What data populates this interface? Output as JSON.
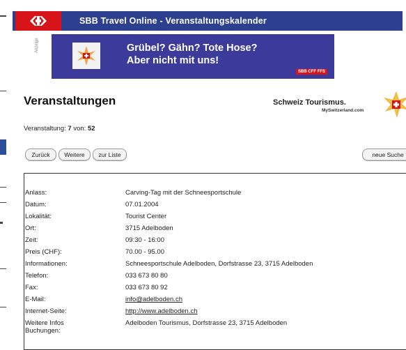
{
  "window": {
    "title": "SBB Travel Online - Veranstaltungskalender"
  },
  "banner": {
    "line1": "Grübel?  Gähn?  Tote Hose?",
    "line2": "Aber nicht mit uns!",
    "brand": "SBB CFF FFS",
    "side_label": "Anzeige"
  },
  "page": {
    "title": "Veranstaltungen",
    "tourism_name": "Schweiz Tourismus.",
    "tourism_site": "MySwitzerland.com",
    "counter_label": "Veranstaltung:",
    "counter_current": "7",
    "counter_of": "von:",
    "counter_total": "52"
  },
  "buttons": {
    "back": "Zurück",
    "next": "Weitere",
    "list": "zur Liste",
    "new_search": "neue Suche"
  },
  "details": [
    {
      "label": "Anlass:",
      "value": "Carving-Tag mit der Schneesportschule"
    },
    {
      "label": "Datum:",
      "value": "07.01.2004"
    },
    {
      "label": "Lokalität:",
      "value": "Tourist Center"
    },
    {
      "label": "Ort:",
      "value": "3715 Adelboden"
    },
    {
      "label": "Zeit:",
      "value": "09:30 - 16:00"
    },
    {
      "label": "Preis (CHF):",
      "value": "70.00 - 95.00"
    },
    {
      "label": "Informationen:",
      "value": "Schneesportschule Adelboden, Dorfstrasse 23, 3715 Adelboden"
    },
    {
      "label": "Telefon:",
      "value": "033 673 80 80"
    },
    {
      "label": "Fax:",
      "value": "033 673 80 92"
    },
    {
      "label": "E-Mail:",
      "value": "info@adelboden.ch"
    },
    {
      "label": "Internet-Seite:",
      "value": "http://www.adelboden.ch"
    },
    {
      "label": "Weitere Infos",
      "label2": "Buchungen:",
      "value": "Adelboden Tourismus, Dorfstrasse 23, 3715 Adelboden"
    }
  ],
  "colors": {
    "titlebar": "#2d3f8f",
    "sbb_red": "#d7141a",
    "banner": "#3c3b9b"
  }
}
